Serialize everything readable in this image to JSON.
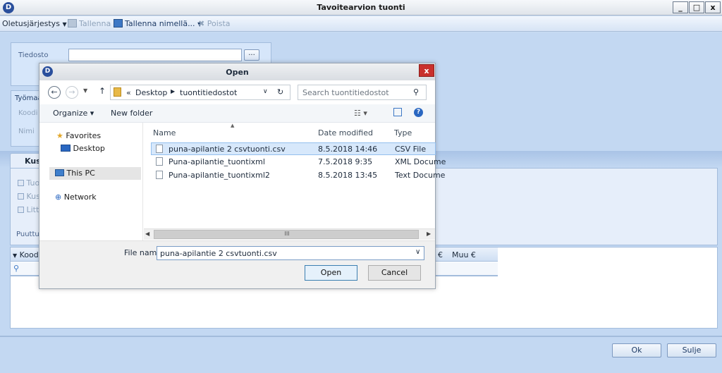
{
  "window": {
    "title": "Tavoitearvion tuonti",
    "buttons": {
      "minimize": "_",
      "maximize": "□",
      "close": "x"
    }
  },
  "toolbar": {
    "default_order": "Oletusjärjestys",
    "save": "Tallenna",
    "save_as": "Tallenna nimellä...",
    "delete": "Poista"
  },
  "form": {
    "file_label": "Tiedosto",
    "browse_button": "...",
    "worksite_label": "Työmaa",
    "code_label": "Koodi",
    "name_label": "Nimi",
    "tab_label": "Kus",
    "checkboxes": [
      "Tuo",
      "Kus",
      "Litte"
    ],
    "missing_label": "Puuttuv"
  },
  "grid": {
    "columns": [
      "Kood",
      "€",
      "Muu €"
    ]
  },
  "footer": {
    "ok": "Ok",
    "close": "Sulje"
  },
  "dialog": {
    "title": "Open",
    "close": "x",
    "address": {
      "prefix": "«",
      "path": [
        "Desktop",
        "tuontitiedostot"
      ]
    },
    "search_placeholder": "Search tuontitiedostot",
    "organize": "Organize ▾",
    "new_folder": "New folder",
    "nav": {
      "favorites": "Favorites",
      "desktop": "Desktop",
      "this_pc": "This PC",
      "network": "Network"
    },
    "columns": {
      "name": "Name",
      "date": "Date modified",
      "type": "Type"
    },
    "files": [
      {
        "name": "puna-apilantie 2 csvtuonti.csv",
        "date": "8.5.2018 14:46",
        "type": "CSV File"
      },
      {
        "name": "Puna-apilantie_tuontixml",
        "date": "7.5.2018 9:35",
        "type": "XML Docume"
      },
      {
        "name": "Puna-apilantie_tuontixml2",
        "date": "8.5.2018 13:45",
        "type": "Text Docume"
      }
    ],
    "file_name_label": "File name:",
    "file_name_value": "puna-apilantie 2 csvtuonti.csv",
    "open_button": "Open",
    "cancel_button": "Cancel",
    "scroll_mark": "III"
  },
  "icons": [
    "app-logo-icon",
    "save-icon",
    "save-as-icon",
    "delete-icon",
    "star-icon",
    "desktop-icon",
    "computer-icon",
    "network-icon",
    "file-icon",
    "folder-icon",
    "refresh-icon",
    "search-icon",
    "help-icon",
    "view-icon",
    "filter-icon"
  ],
  "colors": {
    "accent": "#2a4f9c",
    "panel": "#d6e6fa",
    "selection": "#d7e8fb",
    "close_red": "#c9302c"
  }
}
